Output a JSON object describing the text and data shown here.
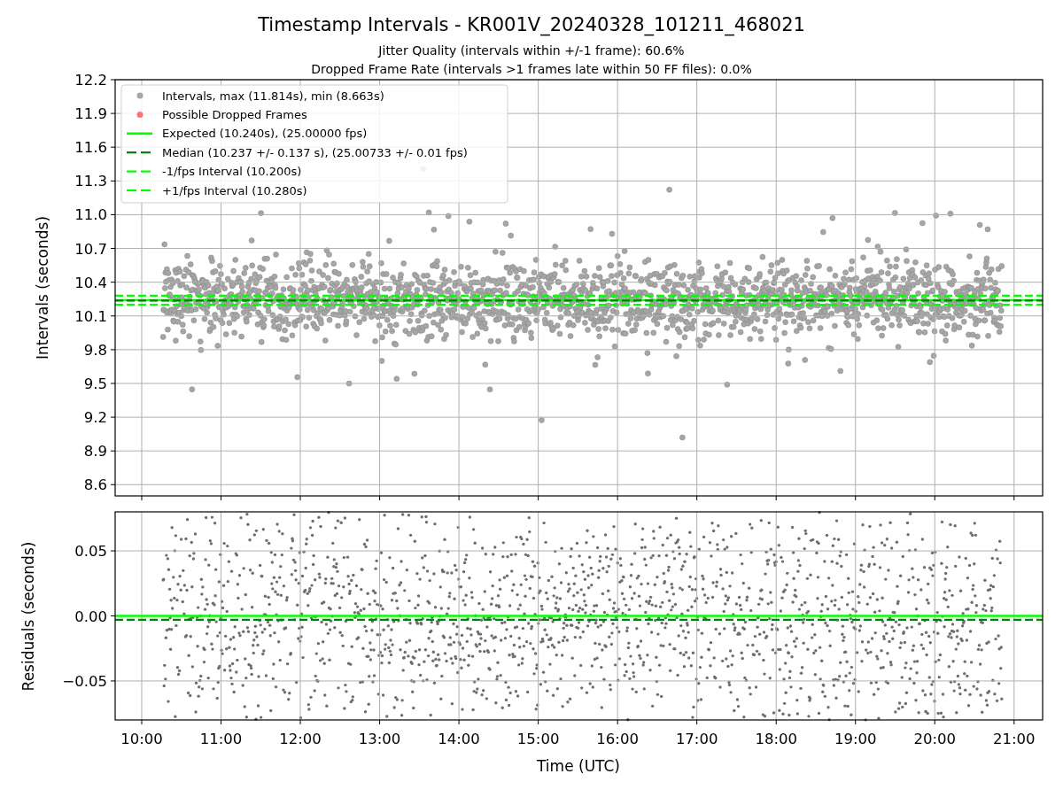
{
  "figure": {
    "title": "Timestamp Intervals - KR001V_20240328_101211_468021",
    "subtitles": [
      "Jitter Quality (intervals within +/-1 frame): 60.6%",
      "Dropped Frame Rate (intervals >1 frames late within 50 FF files): 0.0%"
    ]
  },
  "intervals_plot": {
    "legend": [
      {
        "label": "Intervals, max (11.814s), min (8.663s)",
        "kind": "marker",
        "color": "#a6a6a6"
      },
      {
        "label": "Possible Dropped Frames",
        "kind": "marker",
        "color": "#ff7373"
      },
      {
        "label": "Expected (10.240s), (25.00000 fps)",
        "kind": "solid",
        "color": "#00ff00"
      },
      {
        "label": "Median (10.237 +/- 0.137 s), (25.00733 +/- 0.01 fps)",
        "kind": "dashed",
        "color": "#008000"
      },
      {
        "label": "-1/fps Interval (10.200s)",
        "kind": "dashed",
        "color": "#00ff00"
      },
      {
        "label": "+1/fps Interval (10.280s)",
        "kind": "dashed",
        "color": "#00ff00"
      }
    ],
    "chart_data": {
      "type": "line",
      "ylabel": "Intervals (seconds)",
      "grid": true,
      "x": [
        9.665,
        21.36
      ],
      "xlim": [
        9.665,
        21.36
      ],
      "ylim": [
        8.5,
        12.2
      ],
      "yticks": [
        {
          "value": 8.6,
          "label": "8.6"
        },
        {
          "value": 8.9,
          "label": "8.9"
        },
        {
          "value": 9.2,
          "label": "9.2"
        },
        {
          "value": 9.5,
          "label": "9.5"
        },
        {
          "value": 9.8,
          "label": "9.8"
        },
        {
          "value": 10.1,
          "label": "10.1"
        },
        {
          "value": 10.4,
          "label": "10.4"
        },
        {
          "value": 10.7,
          "label": "10.7"
        },
        {
          "value": 11,
          "label": "11.0"
        },
        {
          "value": 11.3,
          "label": "11.3"
        },
        {
          "value": 11.6,
          "label": "11.6"
        },
        {
          "value": 11.9,
          "label": "11.9"
        },
        {
          "value": 12.2,
          "label": "12.2"
        }
      ],
      "series": [
        {
          "color": "#00ff00",
          "line_style": "solid",
          "values": [
            10.24,
            10.24
          ]
        },
        {
          "color": "#008000",
          "line_style": "dashed",
          "values": [
            10.237,
            10.237
          ]
        },
        {
          "color": "#00ff00",
          "line_style": "dashed",
          "values": [
            10.2,
            10.2
          ]
        },
        {
          "color": "#00ff00",
          "line_style": "dashed",
          "values": [
            10.28,
            10.28
          ]
        }
      ]
    }
  },
  "residuals_plot": {
    "chart_data": {
      "type": "line",
      "xlabel": "Time (UTC)",
      "ylabel": "Residuals (seconds)",
      "grid": true,
      "x": [
        9.665,
        21.36
      ],
      "xlim": [
        9.665,
        21.36
      ],
      "ylim": [
        -0.08,
        0.08
      ],
      "xticks": [
        {
          "value": 10,
          "label": "10:00"
        },
        {
          "value": 11,
          "label": "11:00"
        },
        {
          "value": 12,
          "label": "12:00"
        },
        {
          "value": 13,
          "label": "13:00"
        },
        {
          "value": 14,
          "label": "14:00"
        },
        {
          "value": 15,
          "label": "15:00"
        },
        {
          "value": 16,
          "label": "16:00"
        },
        {
          "value": 17,
          "label": "17:00"
        },
        {
          "value": 18,
          "label": "18:00"
        },
        {
          "value": 19,
          "label": "19:00"
        },
        {
          "value": 20,
          "label": "20:00"
        },
        {
          "value": 21,
          "label": "21:00"
        }
      ],
      "yticks": [
        {
          "value": -0.05,
          "label": "−0.05"
        },
        {
          "value": 0,
          "label": "0.00"
        },
        {
          "value": 0.05,
          "label": "0.05"
        }
      ],
      "series": [
        {
          "color": "#00ff00",
          "line_style": "solid",
          "values": [
            0,
            0
          ]
        },
        {
          "color": "#008000",
          "line_style": "dashed",
          "values": [
            -0.003,
            -0.003
          ]
        }
      ]
    }
  }
}
